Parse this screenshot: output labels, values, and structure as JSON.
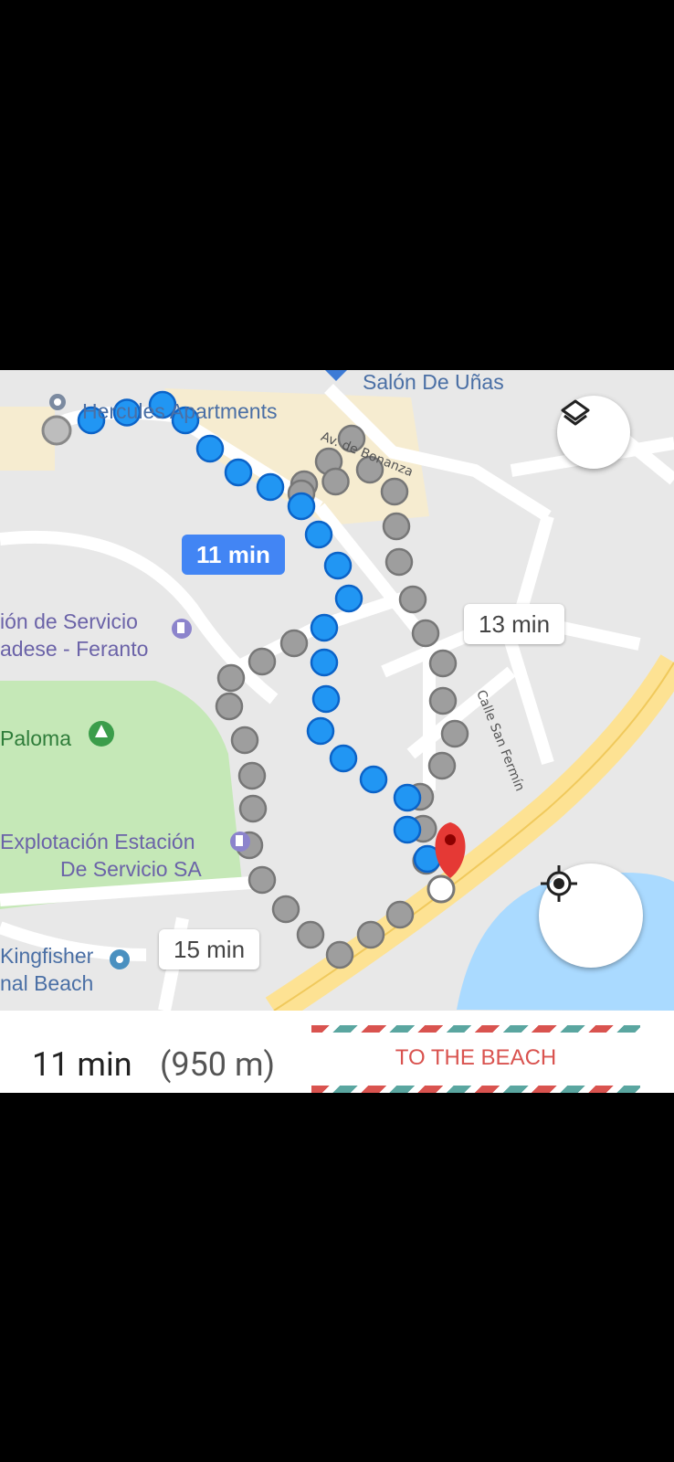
{
  "map": {
    "places": {
      "salon": "Salón De Uñas",
      "hercules": "Hercules Apartments",
      "estacion_line1": "ión de Servicio",
      "estacion_line2": "adese - Feranto",
      "paloma": "Paloma",
      "explotacion_line1": "Explotación Estación",
      "explotacion_line2": "De Servicio SA",
      "kingfisher_line1": "Kingfisher",
      "kingfisher_line2": "nal Beach"
    },
    "streets": {
      "bonanza": "Av. de Bonanza",
      "san_fermin": "Calle San Fermín"
    },
    "routes": [
      {
        "label": "11 min",
        "selected": true
      },
      {
        "label": "13 min",
        "selected": false
      },
      {
        "label": "15 min",
        "selected": false
      }
    ],
    "controls": {
      "layers_icon": "layers-icon",
      "location_icon": "my-location-icon"
    },
    "colors": {
      "route_selected": "#2196f3",
      "route_alt": "#9e9e9e",
      "park": "#c5e8b7",
      "water": "#aadaff",
      "highway": "#fde293"
    }
  },
  "summary": {
    "time": "11 min",
    "distance": "(950 m)",
    "button": "TO THE BEACH"
  }
}
